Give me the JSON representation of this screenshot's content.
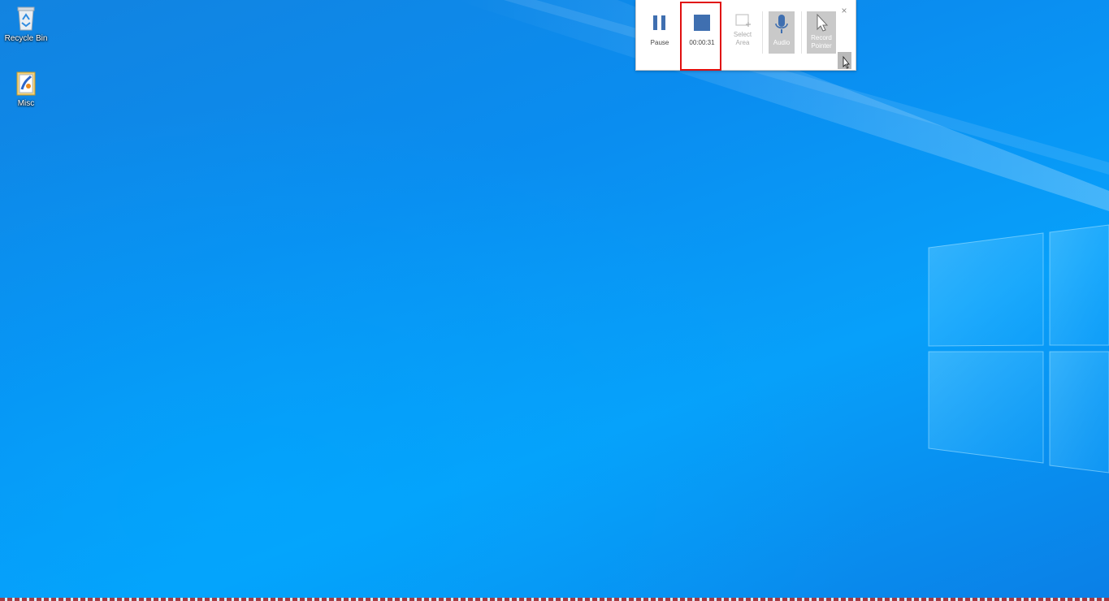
{
  "desktop": {
    "icons": [
      {
        "label": "Recycle Bin",
        "icon": "recycle-bin-icon"
      },
      {
        "label": "Misc",
        "icon": "folder-icon"
      }
    ],
    "accent": "#0a8df0"
  },
  "recording_toolbar": {
    "pause_label": "Pause",
    "timer": "00:00:31",
    "select_area_label": "Select\nArea",
    "audio_label": "Audio",
    "record_pointer_label": "Record\nPointer",
    "close_glyph": "×",
    "highlight_color": "#e01010",
    "button_color": "#3f6fb0"
  }
}
